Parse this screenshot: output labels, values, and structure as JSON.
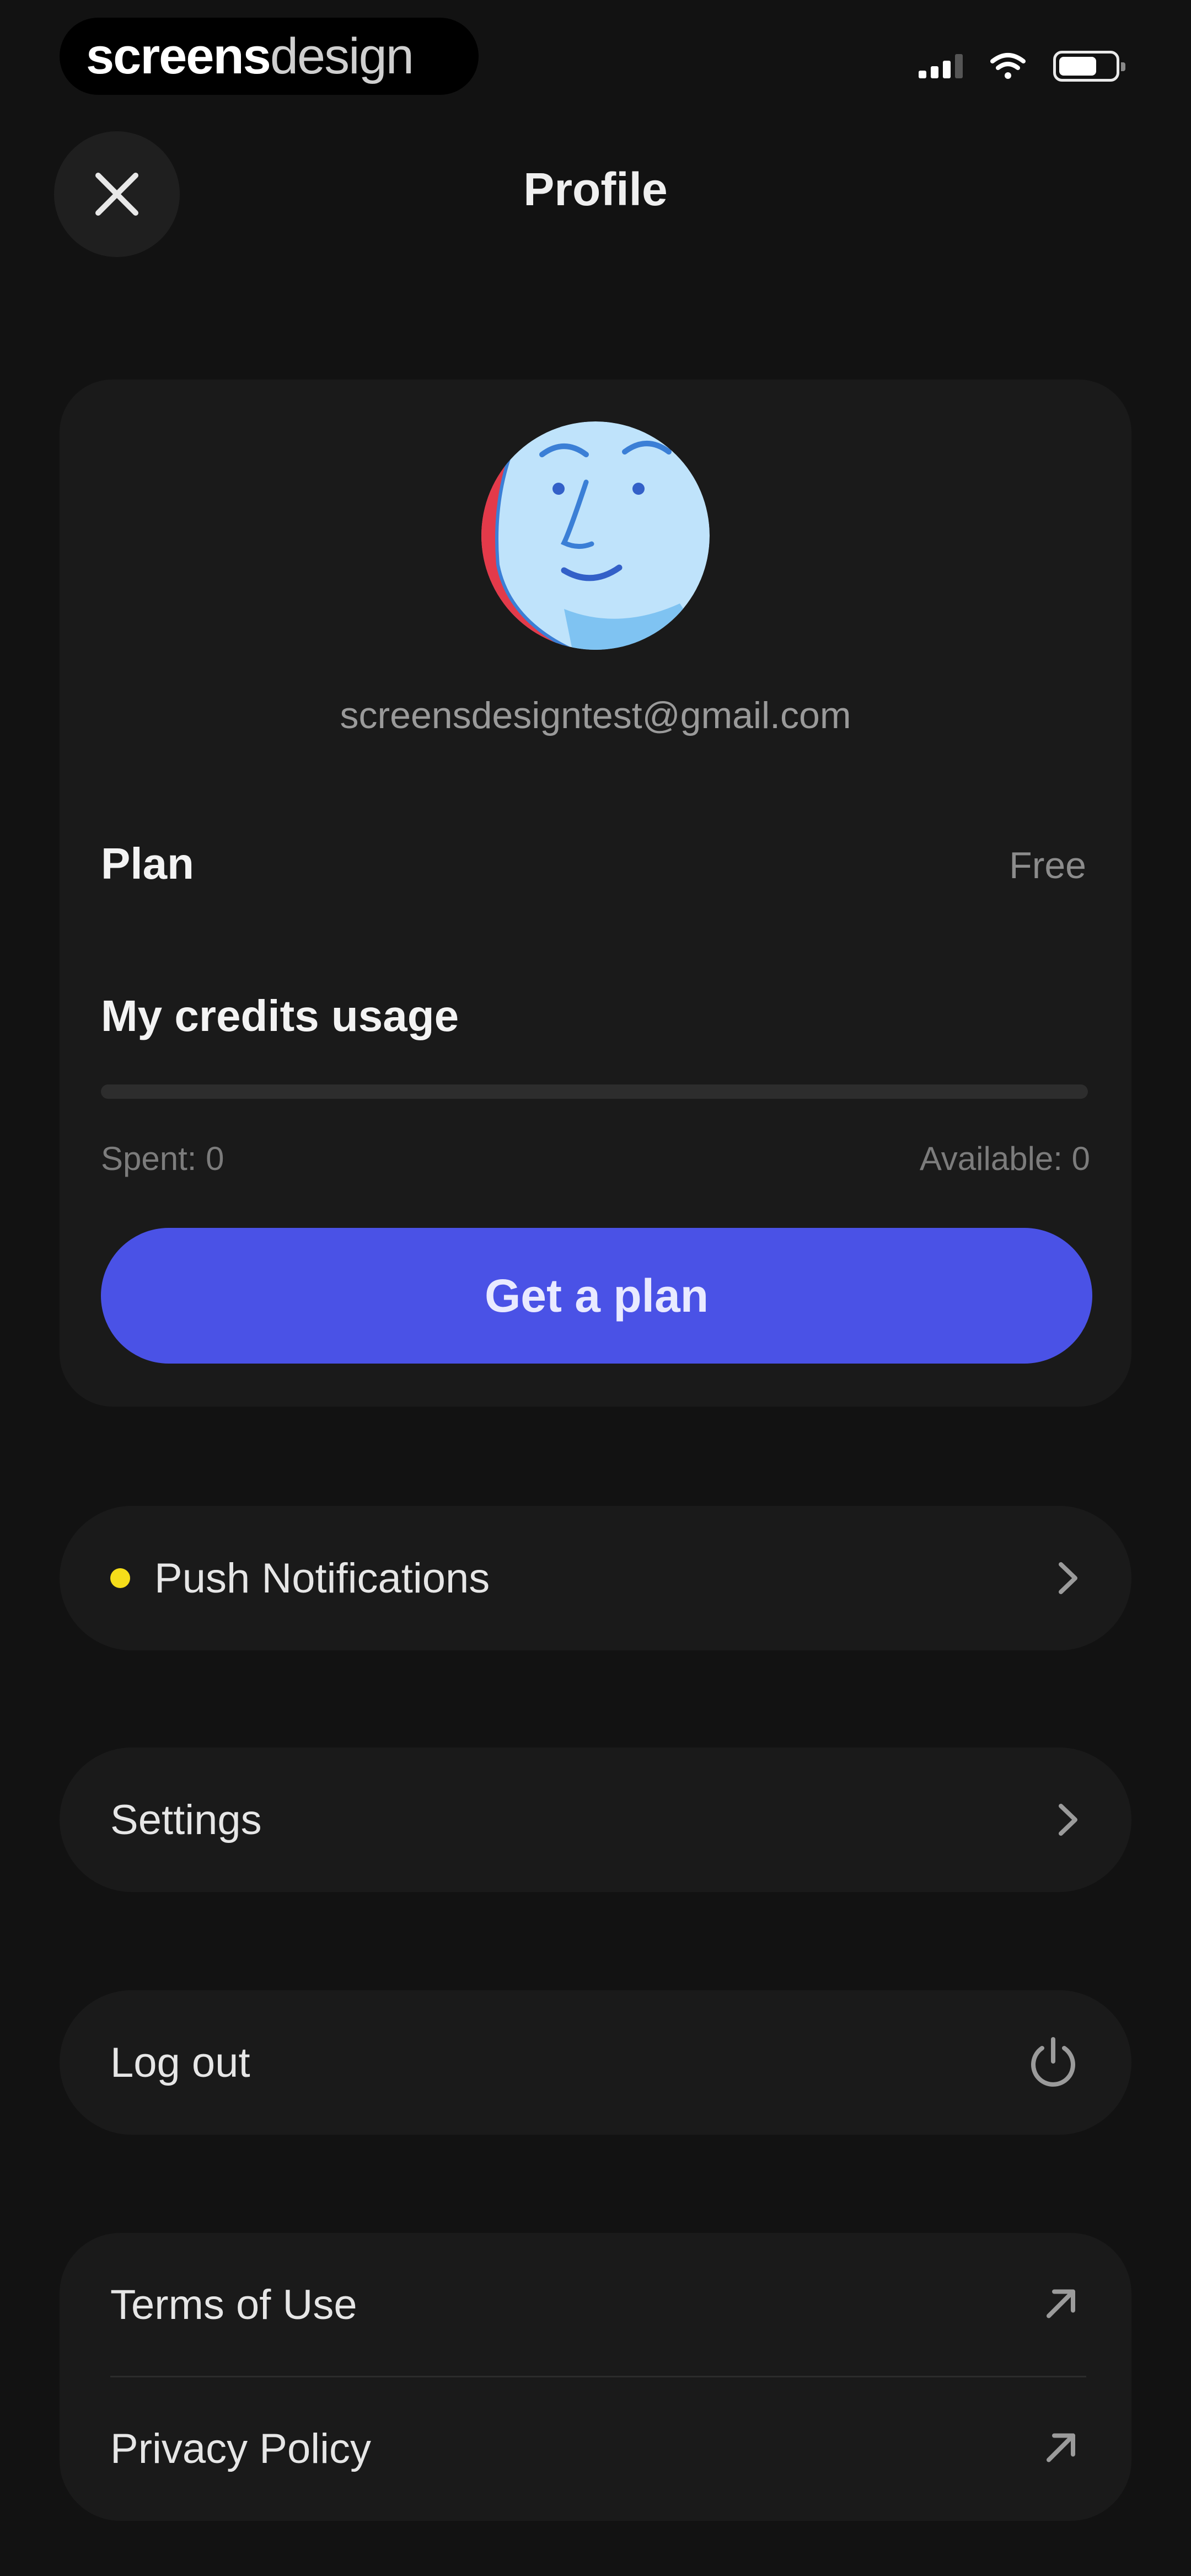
{
  "status_bar": {
    "brand_bold": "screens",
    "brand_light": "design",
    "battery_level": 0.7
  },
  "header": {
    "title": "Profile",
    "close_icon": "close-icon"
  },
  "profile": {
    "email": "screensdesigntest@gmail.com",
    "avatar_icon": "face-avatar",
    "plan_label": "Plan",
    "plan_value": "Free",
    "credits_title": "My credits usage",
    "credits_usage_fraction": 0,
    "spent_text": "Spent: 0",
    "available_text": "Available: 0",
    "get_plan_label": "Get a plan",
    "accent_color": "#4a52e6"
  },
  "menu": {
    "push_notifications": {
      "label": "Push Notifications",
      "indicator_color": "#f5dd1a",
      "icon": "chevron-right-icon"
    },
    "settings": {
      "label": "Settings",
      "icon": "chevron-right-icon"
    },
    "logout": {
      "label": "Log out",
      "icon": "power-icon"
    }
  },
  "links": {
    "terms": {
      "label": "Terms of Use",
      "icon": "external-arrow-icon"
    },
    "privacy": {
      "label": "Privacy Policy",
      "icon": "external-arrow-icon"
    }
  }
}
